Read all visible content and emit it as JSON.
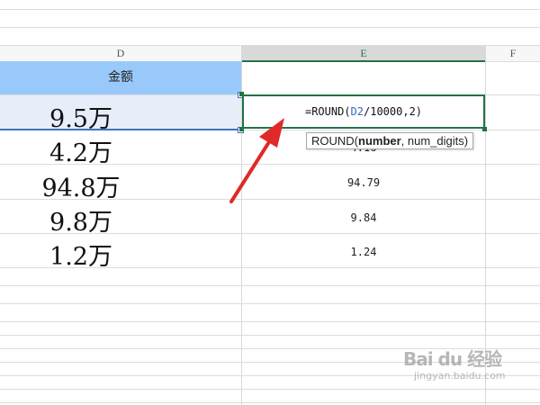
{
  "columns": {
    "d": "D",
    "e": "E",
    "f": "F"
  },
  "header": {
    "amount": "金额"
  },
  "rows": [
    {
      "d": "9.5万",
      "e": ""
    },
    {
      "d": "4.2万",
      "e": "4.16"
    },
    {
      "d": "94.8万",
      "e": "94.79"
    },
    {
      "d": "9.8万",
      "e": "9.84"
    },
    {
      "d": "1.2万",
      "e": "1.24"
    }
  ],
  "formula": {
    "prefix": "=ROUND(",
    "ref": "D2",
    "suffix": "/10000,2)"
  },
  "tooltip": {
    "func": "ROUND(",
    "arg1": "number",
    "rest": ", num_digits)"
  },
  "watermark": {
    "brand": "Bai du 经验",
    "site": "jingyan.baidu.com"
  },
  "colors": {
    "accent_green": "#217346",
    "header_blue": "#99c9fb",
    "arrow_red": "#e02a2a"
  }
}
